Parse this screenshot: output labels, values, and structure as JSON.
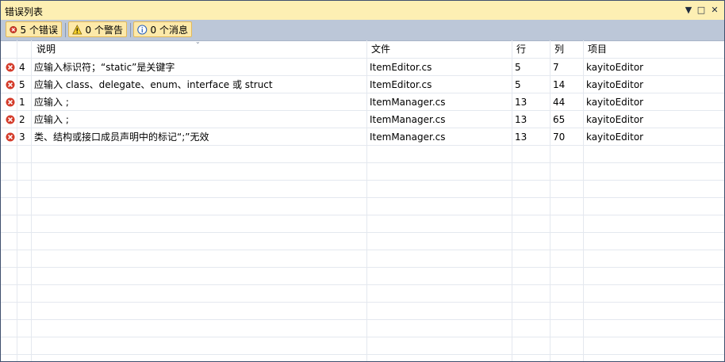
{
  "window": {
    "title": "错误列表"
  },
  "toolbar": {
    "errors_label": "5 个错误",
    "warnings_label": "0 个警告",
    "messages_label": "0 个消息"
  },
  "columns": {
    "desc": "说明",
    "file": "文件",
    "line": "行",
    "col": "列",
    "project": "项目"
  },
  "rows": [
    {
      "num": "4",
      "desc": "应输入标识符；“static”是关键字",
      "file": "ItemEditor.cs",
      "line": "5",
      "col": "7",
      "project": "kayitoEditor"
    },
    {
      "num": "5",
      "desc": "应输入 class、delegate、enum、interface 或 struct",
      "file": "ItemEditor.cs",
      "line": "5",
      "col": "14",
      "project": "kayitoEditor"
    },
    {
      "num": "1",
      "desc": "应输入 ;",
      "file": "ItemManager.cs",
      "line": "13",
      "col": "44",
      "project": "kayitoEditor"
    },
    {
      "num": "2",
      "desc": "应输入 ;",
      "file": "ItemManager.cs",
      "line": "13",
      "col": "65",
      "project": "kayitoEditor"
    },
    {
      "num": "3",
      "desc": "类、结构或接口成员声明中的标记“;”无效",
      "file": "ItemManager.cs",
      "line": "13",
      "col": "70",
      "project": "kayitoEditor"
    }
  ],
  "colors": {
    "title_bg": "#fdefb3",
    "toolbar_bg": "#bcc7d8",
    "error_red": "#d43b2a",
    "warning_yellow": "#f5d02b",
    "info_blue": "#2c62b8"
  },
  "icons": {
    "error": "error-icon",
    "warning": "warning-icon",
    "info": "info-icon"
  }
}
